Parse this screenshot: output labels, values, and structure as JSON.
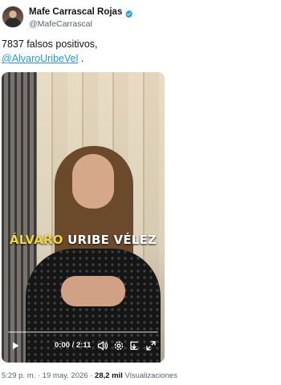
{
  "author": {
    "display_name": "Mafe Carrascal Rojas",
    "handle": "@MafeCarrascal",
    "verified_icon": "verified-badge-icon",
    "verified_color": "#1d9bf0"
  },
  "tweet": {
    "text_line1": "7837 falsos positivos,",
    "mention": "@AlvaroUribeVel",
    "after_mention": " ."
  },
  "video": {
    "caption_first": "ÁLVARO",
    "caption_rest": " URIBE VÉLEZ",
    "caption_first_color": "#f2d43a",
    "time": "0:00 / 2:11",
    "progress": 0.0,
    "icons": [
      "play-icon",
      "volume-icon",
      "settings-icon",
      "captions-icon",
      "fullscreen-icon"
    ]
  },
  "meta": {
    "time": "5:29 p. m.",
    "separator1": " · ",
    "date": "19 may. 2026",
    "separator2": " · ",
    "views_count": "28,2 mil",
    "views_label": " Visualizaciones"
  },
  "colors": {
    "text": "#0f1419",
    "secondary": "#536471",
    "link": "#1d9bf0"
  }
}
